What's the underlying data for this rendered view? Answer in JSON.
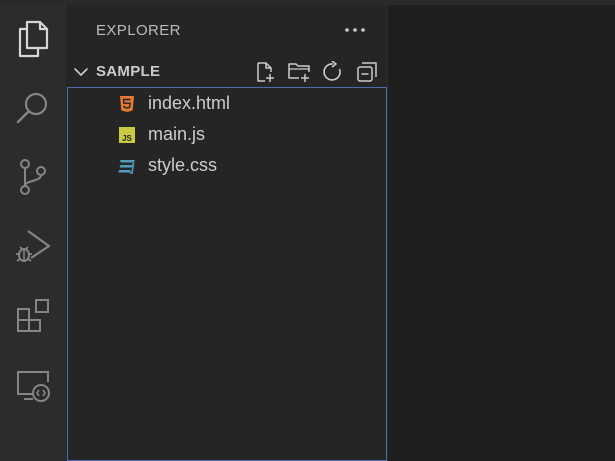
{
  "sidebar": {
    "title": "EXPLORER"
  },
  "folder": {
    "name": "SAMPLE",
    "expanded": true
  },
  "files": [
    {
      "name": "index.html",
      "icon": "html5-icon"
    },
    {
      "name": "main.js",
      "icon": "javascript-icon"
    },
    {
      "name": "style.css",
      "icon": "css3-icon"
    }
  ],
  "activity_bar": [
    "explorer-icon",
    "search-icon",
    "source-control-icon",
    "run-debug-icon",
    "extensions-icon",
    "remote-explorer-icon"
  ],
  "folder_actions": [
    "new-file-icon",
    "new-folder-icon",
    "refresh-icon",
    "collapse-all-icon"
  ],
  "colors": {
    "html": "#e37933",
    "js": "#cbcb41",
    "css": "#519aba",
    "focus_border": "#4d6bab"
  }
}
